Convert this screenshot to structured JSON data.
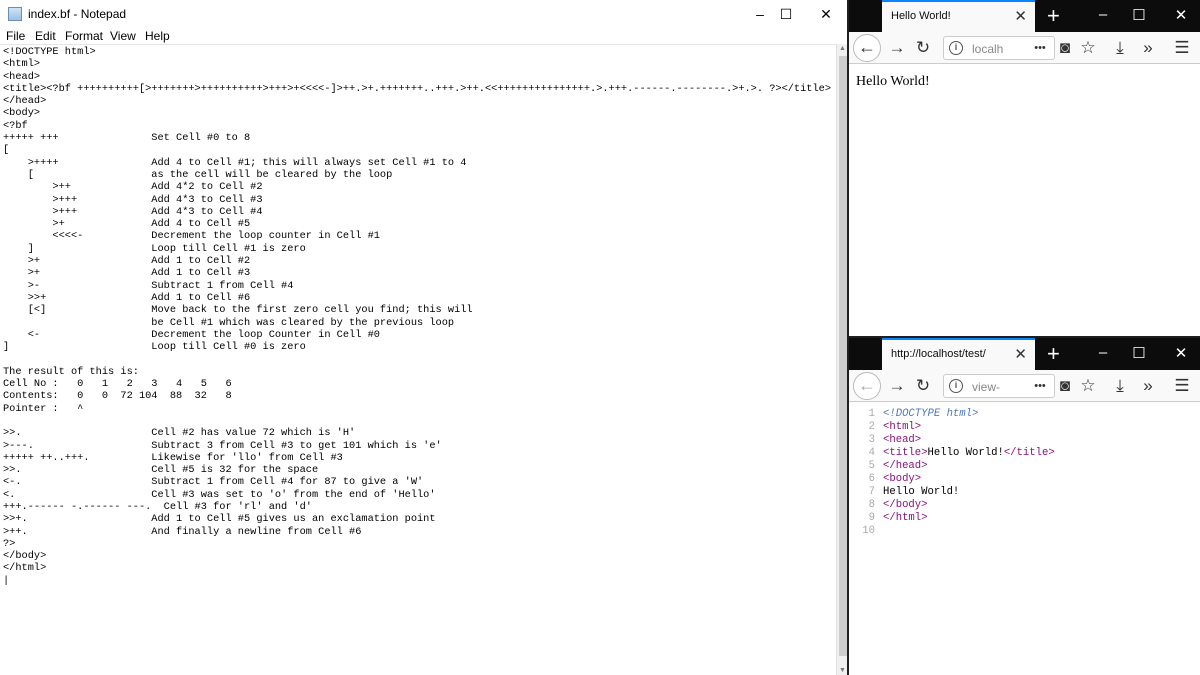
{
  "notepad": {
    "title": "index.bf - Notepad",
    "menu": [
      "File",
      "Edit",
      "Format",
      "View",
      "Help"
    ],
    "lines": [
      "<!DOCTYPE html>",
      "<html>",
      "<head>",
      "<title><?bf ++++++++++[>+++++++>++++++++++>+++>+<<<<-]>++.>+.+++++++..+++.>++.<<+++++++++++++++.>.+++.------.--------.>+.>. ?></title>",
      "</head>",
      "<body>",
      "<?bf",
      "+++++ +++               Set Cell #0 to 8",
      "[",
      "    >++++               Add 4 to Cell #1; this will always set Cell #1 to 4",
      "    [                   as the cell will be cleared by the loop",
      "        >++             Add 4*2 to Cell #2",
      "        >+++            Add 4*3 to Cell #3",
      "        >+++            Add 4*3 to Cell #4",
      "        >+              Add 4 to Cell #5",
      "        <<<<-           Decrement the loop counter in Cell #1",
      "    ]                   Loop till Cell #1 is zero",
      "    >+                  Add 1 to Cell #2",
      "    >+                  Add 1 to Cell #3",
      "    >-                  Subtract 1 from Cell #4",
      "    >>+                 Add 1 to Cell #6",
      "    [<]                 Move back to the first zero cell you find; this will",
      "                        be Cell #1 which was cleared by the previous loop",
      "    <-                  Decrement the loop Counter in Cell #0",
      "]                       Loop till Cell #0 is zero",
      "",
      "The result of this is:",
      "Cell No :   0   1   2   3   4   5   6",
      "Contents:   0   0  72 104  88  32   8",
      "Pointer :   ^",
      "",
      ">>.                     Cell #2 has value 72 which is 'H'",
      ">---.                   Subtract 3 from Cell #3 to get 101 which is 'e'",
      "+++++ ++..+++.          Likewise for 'llo' from Cell #3",
      ">>.                     Cell #5 is 32 for the space",
      "<-.                     Subtract 1 from Cell #4 for 87 to give a 'W'",
      "<.                      Cell #3 was set to 'o' from the end of 'Hello'",
      "+++.------ -.------ ---.  Cell #3 for 'rl' and 'd'",
      ">>+.                    Add 1 to Cell #5 gives us an exclamation point",
      ">++.                    And finally a newline from Cell #6",
      "?>",
      "</body>",
      "</html>",
      "|"
    ]
  },
  "browser_top": {
    "tab_title": "Hello World!",
    "url": "localh",
    "content": "Hello World!"
  },
  "browser_bottom": {
    "tab_title": "http://localhost/test/",
    "url": "view-",
    "source": [
      {
        "n": "1",
        "parts": [
          [
            "doc",
            "<!DOCTYPE html>"
          ]
        ]
      },
      {
        "n": "2",
        "parts": [
          [
            "tag",
            "<html>"
          ]
        ]
      },
      {
        "n": "3",
        "parts": [
          [
            "tag",
            "<head>"
          ]
        ]
      },
      {
        "n": "4",
        "parts": [
          [
            "tag",
            "<title>"
          ],
          [
            "txt",
            "Hello World!"
          ],
          [
            "tag",
            "</title>"
          ]
        ]
      },
      {
        "n": "5",
        "parts": [
          [
            "tag",
            "</head>"
          ]
        ]
      },
      {
        "n": "6",
        "parts": [
          [
            "tag",
            "<body>"
          ]
        ]
      },
      {
        "n": "7",
        "parts": [
          [
            "txt",
            "Hello World!"
          ]
        ]
      },
      {
        "n": "8",
        "parts": [
          [
            "tag",
            "</body>"
          ]
        ]
      },
      {
        "n": "9",
        "parts": [
          [
            "tag",
            "</html>"
          ]
        ]
      },
      {
        "n": "10",
        "parts": []
      }
    ]
  },
  "icons": {
    "minimize": "–",
    "maximize": "☐",
    "close": "✕",
    "back": "←",
    "forward": "→",
    "reload": "↻",
    "more": "•••",
    "pocket": "◙",
    "star": "☆",
    "download": "⤓",
    "overflow": "»",
    "menu": "☰",
    "new_tab": "+",
    "info": "i"
  },
  "colors": {
    "accent": "#0a84ff",
    "tabbar": "#0c0c0d",
    "tag": "#881280",
    "doctype": "#4f79ba"
  }
}
